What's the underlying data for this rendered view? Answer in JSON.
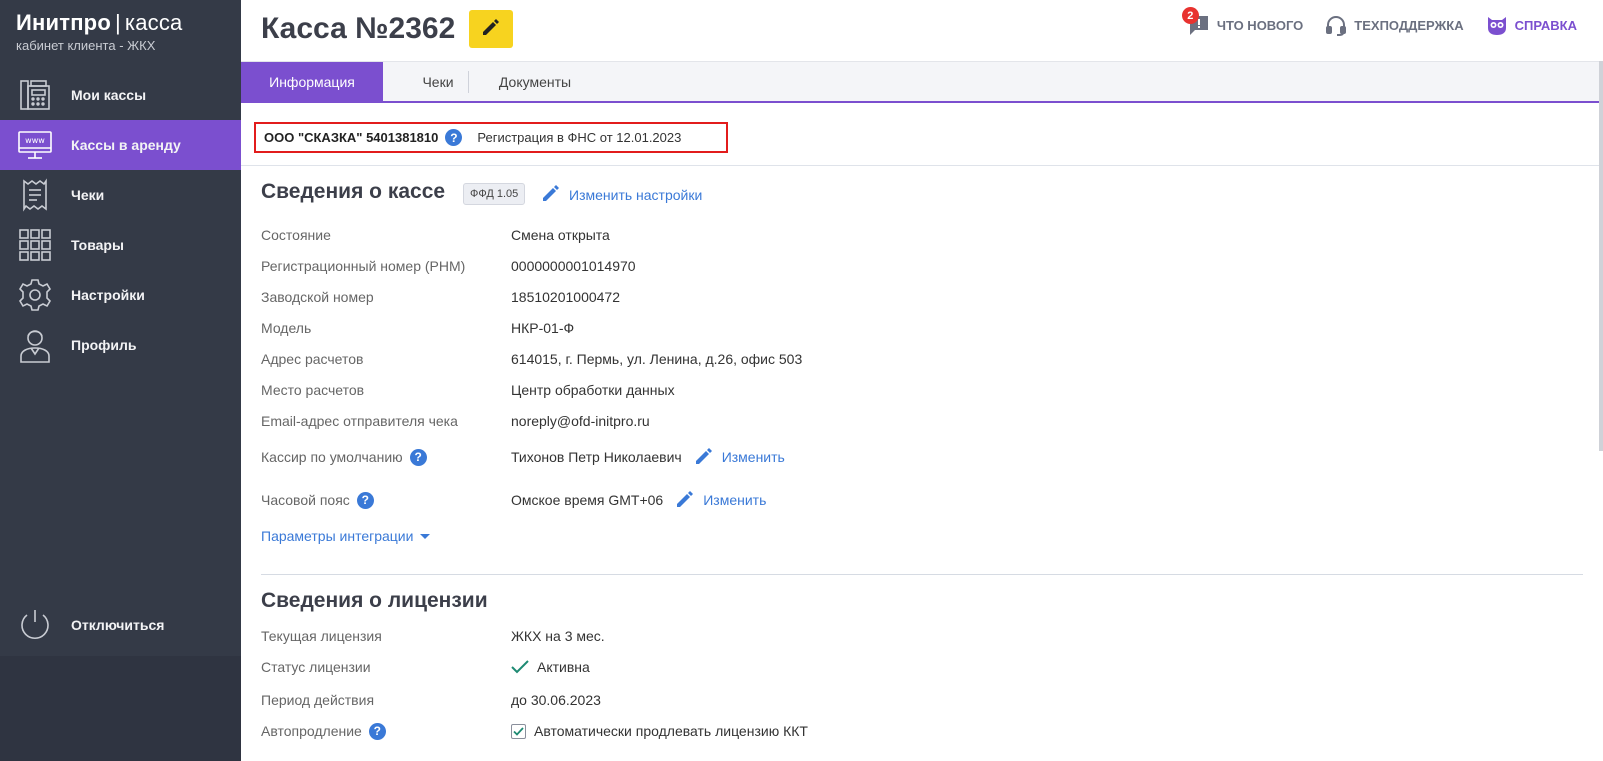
{
  "brand": {
    "name": "Инитпро",
    "separator": "|",
    "product": "касса",
    "subtitle": "кабинет клиента - ЖКХ"
  },
  "sidebar": {
    "items": [
      {
        "label": "Мои кассы",
        "icon": "cash-register-icon"
      },
      {
        "label": "Кассы в аренду",
        "icon": "www-monitor-icon",
        "active": true
      },
      {
        "label": "Чеки",
        "icon": "receipt-icon"
      },
      {
        "label": "Товары",
        "icon": "grid-icon"
      },
      {
        "label": "Настройки",
        "icon": "gear-icon"
      },
      {
        "label": "Профиль",
        "icon": "profile-icon"
      }
    ],
    "logout_label": "Отключиться"
  },
  "header": {
    "title": "Касса №2362",
    "edit_icon": "pencil-icon",
    "links": {
      "news": "ЧТО НОВОГО",
      "news_badge": "2",
      "support": "ТЕХПОДДЕРЖКА",
      "help": "СПРАВКА"
    }
  },
  "tabs": [
    "Информация",
    "Чеки",
    "Документы"
  ],
  "org": {
    "name": "ООО \"СКАЗКА\" 5401381810",
    "help_glyph": "?",
    "registration": "Регистрация в ФНС от 12.01.2023"
  },
  "kassa": {
    "title": "Сведения о кассе",
    "ffd": "ФФД 1.05",
    "change_settings": "Изменить настройки",
    "rows": [
      {
        "label": "Состояние",
        "value": "Смена открыта"
      },
      {
        "label": "Регистрационный номер (РНМ)",
        "value": "0000000001014970"
      },
      {
        "label": "Заводской номер",
        "value": "18510201000472"
      },
      {
        "label": "Модель",
        "value": "НКР-01-Ф"
      },
      {
        "label": "Адрес расчетов",
        "value": "614015, г. Пермь, ул. Ленина, д.26, офис 503"
      },
      {
        "label": "Место расчетов",
        "value": "Центр обработки данных"
      },
      {
        "label": "Email-адрес отправителя чека",
        "value": "noreply@ofd-initpro.ru"
      }
    ],
    "cashier": {
      "label": "Кассир по умолчанию",
      "value": "Тихонов Петр Николаевич",
      "link": "Изменить"
    },
    "timezone": {
      "label": "Часовой пояс",
      "value": "Омское время GMT+06",
      "link": "Изменить"
    },
    "integration": "Параметры интеграции"
  },
  "license": {
    "title": "Сведения о лицензии",
    "rows": [
      {
        "label": "Текущая лицензия",
        "value": "ЖКХ на 3 мес."
      },
      {
        "label": "Статус лицензии",
        "value": "Активна"
      },
      {
        "label": "Период действия",
        "value": "до 30.06.2023"
      }
    ],
    "autorenew": {
      "label": "Автопродление",
      "checkbox_label": "Автоматически продлевать лицензию ККТ",
      "checked": true
    }
  },
  "colors": {
    "sidebar": "#343a47",
    "accent": "#7b4fcf",
    "link": "#3a79d7",
    "edit_button": "#f7d31f",
    "highlight_border": "#e21c1c"
  }
}
